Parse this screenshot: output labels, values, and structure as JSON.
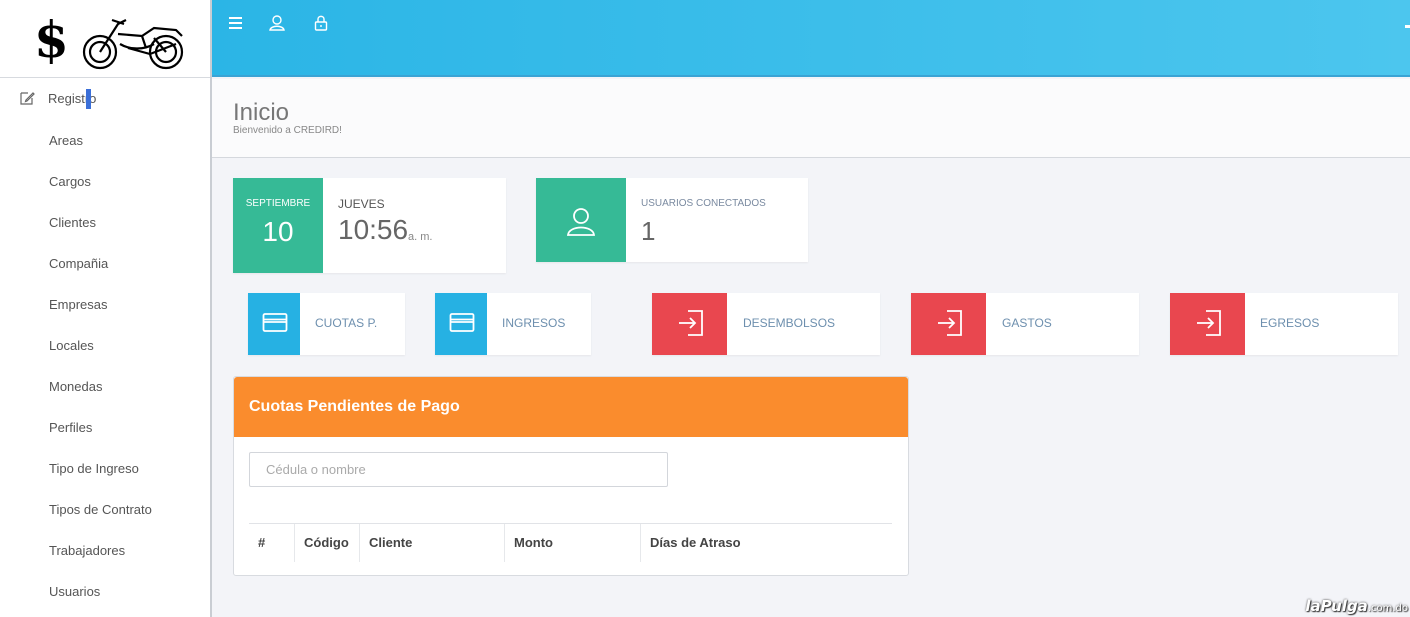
{
  "logo": {
    "symbol": "$"
  },
  "sidebar": {
    "section_label": "Registro",
    "items": [
      "Areas",
      "Cargos",
      "Clientes",
      "Compañia",
      "Empresas",
      "Locales",
      "Monedas",
      "Perfiles",
      "Tipo de Ingreso",
      "Tipos de Contrato",
      "Trabajadores",
      "Usuarios"
    ]
  },
  "header": {
    "title": "Inicio",
    "subtitle": "Bienvenido a CREDIRD!"
  },
  "date_card": {
    "month": "SEPTIEMBRE",
    "day": "10",
    "weekday": "JUEVES",
    "time": "10:56",
    "ampm": "a. m."
  },
  "users_card": {
    "label": "USUARIOS CONECTADOS",
    "count": "1"
  },
  "shortcuts": [
    "CUOTAS P.",
    "INGRESOS",
    "DESEMBOLSOS",
    "GASTOS",
    "EGRESOS"
  ],
  "pending_panel": {
    "title": "Cuotas Pendientes de Pago",
    "search_placeholder": "Cédula o nombre",
    "columns": [
      "#",
      "Código",
      "Cliente",
      "Monto",
      "Días de Atraso"
    ]
  },
  "watermark": {
    "brand": "laPulga",
    "domain": ".com.do"
  },
  "colors": {
    "topbar": "#2bb5e6",
    "green": "#36ba96",
    "blue": "#26b1e3",
    "red": "#e9474f",
    "orange": "#fa8c2d"
  }
}
